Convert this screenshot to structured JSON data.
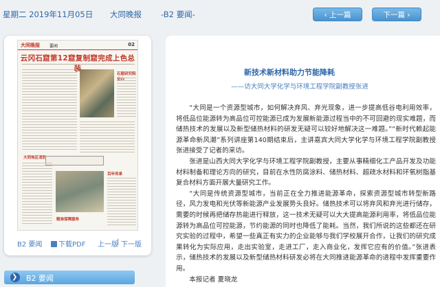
{
  "topbar": {
    "date": "星期二 2019年11月05日",
    "paper": "大同晚报",
    "page": "-B2 要闻-",
    "prev_label": "上一篇",
    "next_label": "下一篇",
    "prev_icon": "chevron-left-icon",
    "next_icon": "chevron-right-icon"
  },
  "thumbnail": {
    "logo": "大同晚报",
    "section": "要闻",
    "page_no": "02",
    "headline": "云冈石窟第12窟复制窟完成上色总装",
    "side_heads": [
      "石窟研究院举办",
      "大同地区消防",
      "百年传承",
      "精准保障服务"
    ]
  },
  "panel": {
    "page_link": "B2 要闻",
    "pdf_label": "下载PDF",
    "prev_page": "上一版",
    "separator": "|",
    "next_page": "下一版"
  },
  "bottom": {
    "label": "B2 要闻"
  },
  "article": {
    "title": "新技术新材料助力节能降耗",
    "subtitle": "——访大同大学化学与环境工程学院副教授张进",
    "paragraphs": [
      "“大同是一个资源型城市，如何解决弃风、弃光现象，进一步提高低谷电利用效率，将低品位能源转为高品位可控能源已成为发展新能源过程当中的不可回避的现实难题，而储热技术的发展以及新型储热材料的研发无疑可以较好地解决这一难题。”“新时代赖起能源革命新风潮”系列讲座第140期结束后，主讲嘉宾大同大学化学与环境工程学院副教授张进接受了记者的采访。",
      "张进是山西大同大学化学与环境工程学院副教授，主要从事精细化工产品开发及功能材料制备和理论方向的研究，目前在水性防腐涂料、储热材料、超疏水材料和环氧树脂基复合材料方面开展大量研究工作。",
      "“大同是传统资源型城市，当前正在全力推进能源革命，探索资源型城市转型新路径，风力发电和光伏等新能源产业发展势头良好。储热技术可以将弃风和弃光进行储存，需要的时候再把储存热能进行释放，这一技术无疑可以大大提高能源利用率，将低品位能源转为高品位可控能源，节约能源的同时也降低了能耗。当然，我们所说的这些都还在研究实验的过程中，希望一些真正有实力的企业能够与我们学校展开合作，让我们的研究成果转化为实际应用，走出实验室，走进工厂，走入商业化，发挥它应有的价值。”张进表示，储热技术的发展以及新型储热材料研发必将在大同推进能源革命的进程中发挥重要作用。",
      "本报记者 夏晓龙"
    ]
  }
}
